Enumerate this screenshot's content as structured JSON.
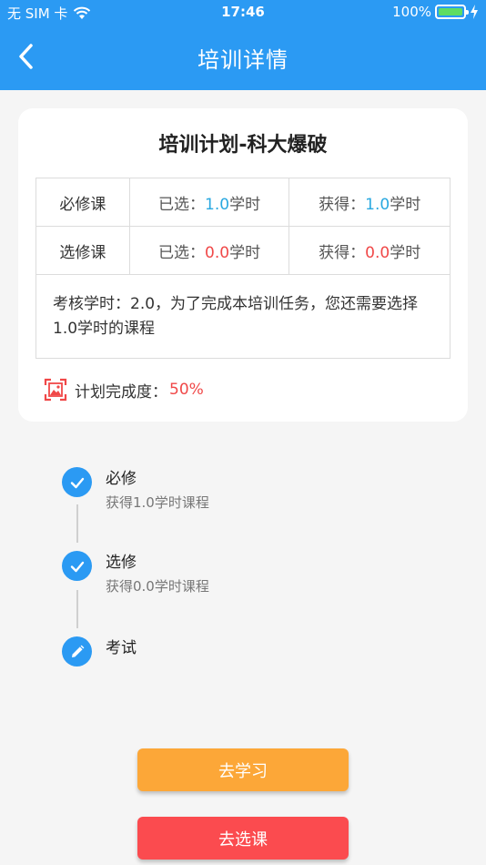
{
  "status_bar": {
    "carrier": "无 SIM 卡",
    "time": "17:46",
    "battery": "100%"
  },
  "nav": {
    "title": "培训详情"
  },
  "card": {
    "title": "培训计划-科大爆破",
    "rows": [
      {
        "label": "必修课",
        "selected_prefix": "已选：",
        "selected_value": "1.0",
        "selected_unit": "学时",
        "earned_prefix": "获得：",
        "earned_value": "1.0",
        "earned_unit": "学时"
      },
      {
        "label": "选修课",
        "selected_prefix": "已选：",
        "selected_value": "0.0",
        "selected_unit": "学时",
        "earned_prefix": "获得：",
        "earned_value": "0.0",
        "earned_unit": "学时"
      }
    ],
    "note": "考核学时：2.0，为了完成本培训任务，您还需要选择1.0学时的课程",
    "progress_label": "计划完成度：",
    "progress_value": "50%"
  },
  "timeline": [
    {
      "name": "必修",
      "sub": "获得1.0学时课程",
      "icon": "check-icon"
    },
    {
      "name": "选修",
      "sub": "获得0.0学时课程",
      "icon": "check-icon"
    },
    {
      "name": "考试",
      "sub": "",
      "icon": "pencil-icon"
    }
  ],
  "buttons": {
    "study": "去学习",
    "select": "去选课"
  },
  "colors": {
    "primary": "#2b9af3",
    "value_blue": "#29a8e0",
    "value_red": "#f04848",
    "btn_orange": "#fca738",
    "btn_red": "#fb4b4f"
  }
}
